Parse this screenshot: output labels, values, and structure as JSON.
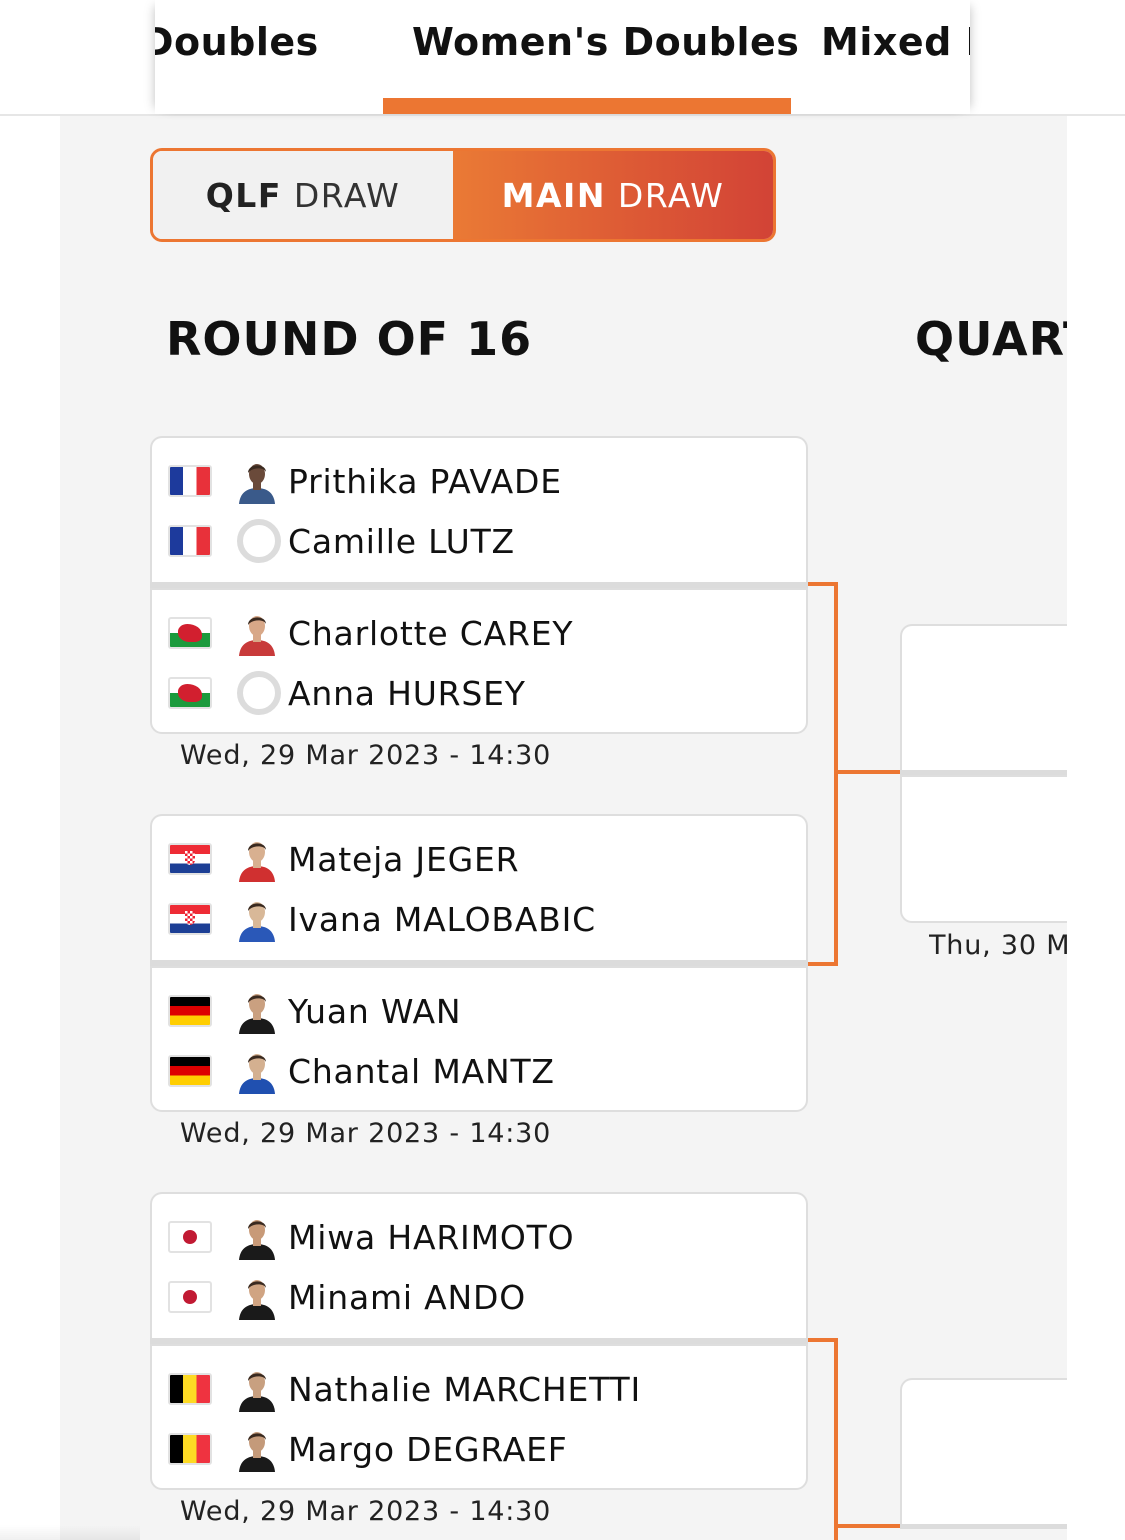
{
  "tabs": [
    {
      "label": "'s Doubles",
      "active": false
    },
    {
      "label": "Women's Doubles",
      "active": true
    },
    {
      "label": "Mixed D",
      "active": false
    }
  ],
  "draw_toggle": {
    "qlf": {
      "prefix": "QLF",
      "suffix": " DRAW",
      "active": false
    },
    "main": {
      "prefix": "MAIN",
      "suffix": " DRAW",
      "active": true
    }
  },
  "rounds": {
    "r16": "ROUND OF 16",
    "qf": "QUART"
  },
  "colors": {
    "accent": "#ec7632",
    "accent_dark": "#d24336"
  },
  "matches": [
    {
      "date": "Wed, 29 Mar 2023 - 14:30",
      "teams": [
        {
          "flag": "flag-fr",
          "players": [
            {
              "name": "Prithika PAVADE",
              "avatar": "player-photo"
            },
            {
              "name": "Camille LUTZ",
              "avatar": "placeholder-avatar"
            }
          ]
        },
        {
          "flag": "flag-wales",
          "players": [
            {
              "name": "Charlotte CAREY",
              "avatar": "player-photo"
            },
            {
              "name": "Anna HURSEY",
              "avatar": "placeholder-avatar"
            }
          ]
        }
      ]
    },
    {
      "date": "Wed, 29 Mar 2023 - 14:30",
      "teams": [
        {
          "flag": "flag-hr",
          "players": [
            {
              "name": "Mateja JEGER",
              "avatar": "player-photo"
            },
            {
              "name": "Ivana MALOBABIC",
              "avatar": "player-photo"
            }
          ]
        },
        {
          "flag": "flag-de",
          "players": [
            {
              "name": "Yuan WAN",
              "avatar": "player-photo"
            },
            {
              "name": "Chantal MANTZ",
              "avatar": "player-photo"
            }
          ]
        }
      ]
    },
    {
      "date": "Wed, 29 Mar 2023 - 14:30",
      "teams": [
        {
          "flag": "flag-jp",
          "players": [
            {
              "name": "Miwa HARIMOTO",
              "avatar": "player-photo"
            },
            {
              "name": "Minami ANDO",
              "avatar": "player-photo"
            }
          ]
        },
        {
          "flag": "flag-be",
          "players": [
            {
              "name": "Nathalie MARCHETTI",
              "avatar": "player-photo"
            },
            {
              "name": "Margo DEGRAEF",
              "avatar": "player-photo"
            }
          ]
        }
      ]
    }
  ],
  "quarter_final": {
    "date": "Thu, 30 M"
  }
}
